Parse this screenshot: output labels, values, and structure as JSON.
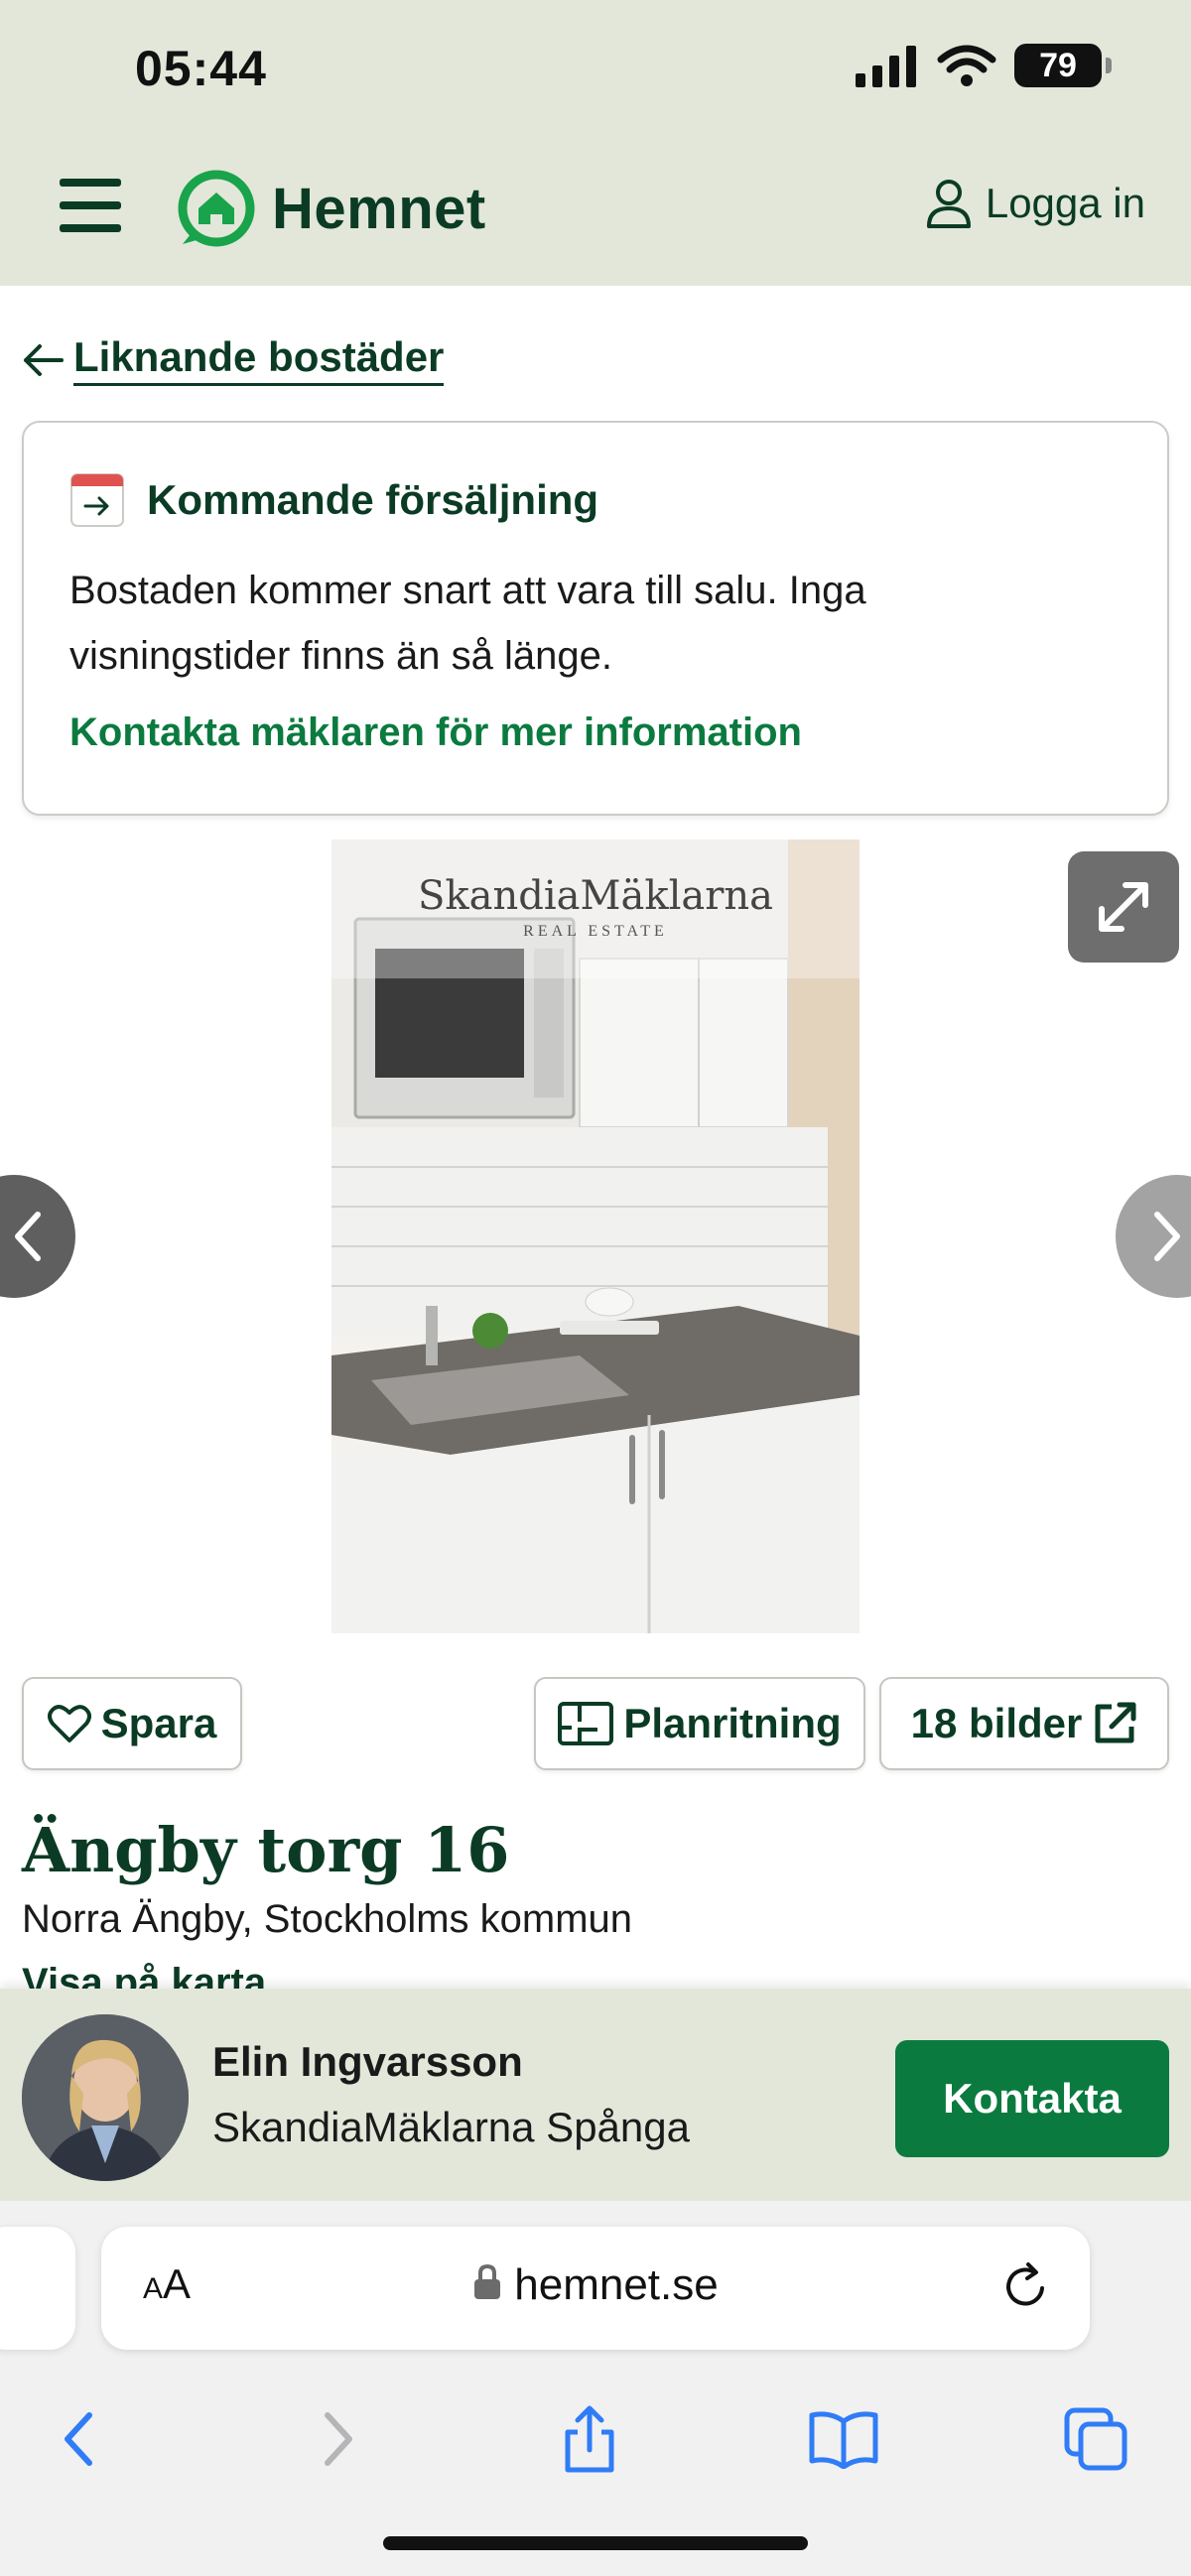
{
  "status_bar": {
    "time": "05:44",
    "battery": "79"
  },
  "header": {
    "logo_text": "Hemnet",
    "login_label": "Logga in"
  },
  "back_link": {
    "label": "Liknande bostäder"
  },
  "sale_card": {
    "title": "Kommande försäljning",
    "text": "Bostaden kommer snart att vara till salu. Inga visningstider finns än så länge.",
    "link": "Kontakta mäklaren för mer information"
  },
  "gallery": {
    "watermark_brand": "SkandiaMäklarna",
    "watermark_sub": "REAL ESTATE"
  },
  "actions": {
    "save_label": "Spara",
    "floorplan_label": "Planritning",
    "photos_label": "18 bilder"
  },
  "listing": {
    "address": "Ängby torg 16",
    "area": "Norra Ängby, Stockholms kommun",
    "map_link": "Visa på karta"
  },
  "agent": {
    "name": "Elin Ingvarsson",
    "office": "SkandiaMäklarna Spånga",
    "contact_label": "Kontakta"
  },
  "browser": {
    "aa_small": "A",
    "aa_large": "A",
    "url": "hemnet.se"
  },
  "colors": {
    "brand_dark": "#0b3b24",
    "brand_green": "#0b7a3f",
    "header_bg": "#e2e7da"
  }
}
